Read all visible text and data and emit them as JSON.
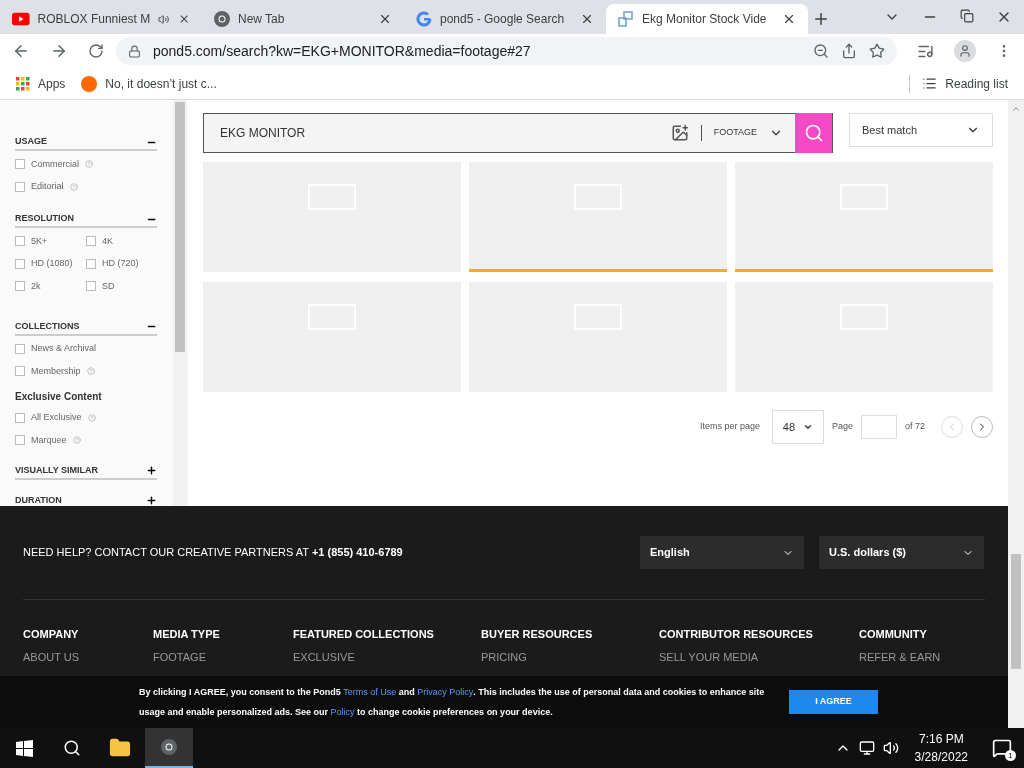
{
  "browser": {
    "tabs": [
      {
        "title": "ROBLOX Funniest M",
        "audio": true,
        "selected": false
      },
      {
        "title": "New Tab",
        "audio": false,
        "selected": false
      },
      {
        "title": "pond5 - Google Search",
        "audio": false,
        "selected": false
      },
      {
        "title": "Ekg Monitor Stock Vide",
        "audio": false,
        "selected": true
      }
    ],
    "url": "pond5.com/search?kw=EKG+MONITOR&media=footage#27",
    "bookmarks": [
      {
        "label": "Apps"
      },
      {
        "label": "No, it doesn’t just c..."
      }
    ],
    "reading_list": "Reading list"
  },
  "sidebar": [
    {
      "kind": "section",
      "title": "USAGE",
      "expanded": true,
      "options": [
        {
          "label": "Commercial",
          "checked": false,
          "help": true
        },
        {
          "label": "Editorial",
          "checked": false,
          "help": true
        }
      ]
    },
    {
      "kind": "section",
      "title": "RESOLUTION",
      "expanded": true,
      "options": [
        {
          "label": "5K+",
          "checked": false,
          "help": false
        },
        {
          "label": "4K",
          "checked": false,
          "help": false
        },
        {
          "label": "HD (1080)",
          "checked": false,
          "help": false
        },
        {
          "label": "HD (720)",
          "checked": false,
          "help": false
        },
        {
          "label": "2k",
          "checked": false,
          "help": false
        },
        {
          "label": "SD",
          "checked": false,
          "help": false
        }
      ]
    },
    {
      "kind": "section",
      "title": "COLLECTIONS",
      "expanded": true,
      "options": [
        {
          "label": "News & Archival",
          "checked": false,
          "help": false
        },
        {
          "label": "Membership",
          "checked": false,
          "help": true
        }
      ]
    },
    {
      "kind": "subheading",
      "title": "Exclusive Content",
      "options": [
        {
          "label": "All Exclusive",
          "checked": false,
          "help": true
        },
        {
          "label": "Marquee",
          "checked": false,
          "help": true
        }
      ]
    },
    {
      "kind": "section",
      "title": "VISUALLY SIMILAR",
      "expanded": false
    },
    {
      "kind": "section",
      "title": "DURATION",
      "expanded": false
    }
  ],
  "search": {
    "value": "EKG MONITOR",
    "media": "FOOTAGE",
    "sort": "Best match"
  },
  "results": [
    {
      "active": false
    },
    {
      "active": true
    },
    {
      "active": true
    },
    {
      "active": false
    },
    {
      "active": false
    },
    {
      "active": false
    }
  ],
  "pagination": {
    "items_label": "Items per page",
    "per_page": "48",
    "page_label": "Page",
    "of": "of 72"
  },
  "footer": {
    "help": "NEED HELP? CONTACT OUR CREATIVE PARTNERS AT ",
    "phone": "+1 (855) 410-6789",
    "language": "English",
    "currency": "U.S. dollars ($)",
    "columns": [
      {
        "title": "COMPANY",
        "links": [
          "ABOUT US"
        ]
      },
      {
        "title": "MEDIA TYPE",
        "links": [
          "FOOTAGE"
        ]
      },
      {
        "title": "FEATURED COLLECTIONS",
        "links": [
          "EXCLUSIVE"
        ]
      },
      {
        "title": "BUYER RESOURCES",
        "links": [
          "PRICING"
        ]
      },
      {
        "title": "CONTRIBUTOR RESOURCES",
        "links": [
          "SELL YOUR MEDIA"
        ]
      },
      {
        "title": "COMMUNITY",
        "links": [
          "REFER & EARN"
        ]
      }
    ]
  },
  "cookie": {
    "parts": [
      {
        "kind": "text",
        "text": "By clicking I AGREE, you consent to the Pond5 "
      },
      {
        "kind": "link",
        "text": "Terms of Use"
      },
      {
        "kind": "text",
        "text": " and "
      },
      {
        "kind": "link",
        "text": "Privacy Policy"
      },
      {
        "kind": "text",
        "text": ". This includes the use of personal data and cookies to enhance site usage and enable personalized ads. See our "
      },
      {
        "kind": "link",
        "text": "Policy"
      },
      {
        "kind": "text",
        "text": " to change cookie preferences on your device."
      }
    ],
    "button": "I AGREE"
  },
  "taskbar": {
    "time": "7:16 PM",
    "date": "3/28/2022",
    "notifications": "1"
  }
}
